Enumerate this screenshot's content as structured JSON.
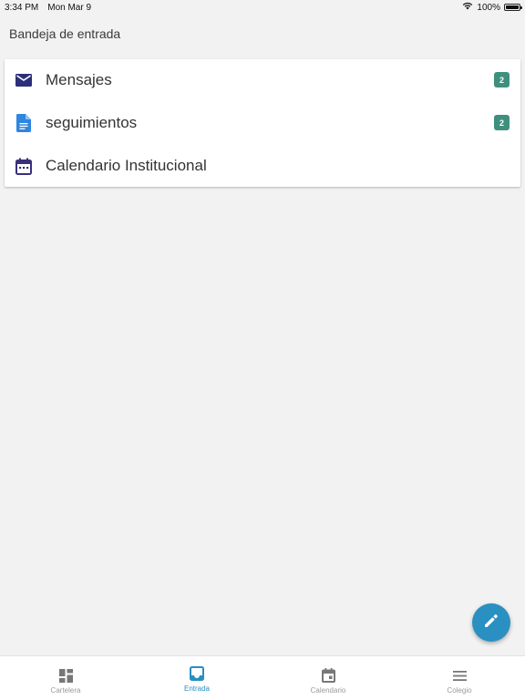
{
  "status_bar": {
    "time": "3:34 PM",
    "date": "Mon Mar 9",
    "battery": "100%"
  },
  "header": {
    "title": "Bandeja de entrada"
  },
  "inbox": {
    "items": [
      {
        "label": "Mensajes",
        "badge": "2",
        "icon": "mail-icon"
      },
      {
        "label": "seguimientos",
        "badge": "2",
        "icon": "document-icon"
      },
      {
        "label": "Calendario Institucional",
        "badge": "",
        "icon": "calendar-icon"
      }
    ]
  },
  "fab": {
    "icon": "pencil-icon"
  },
  "bottom_nav": {
    "items": [
      {
        "label": "Cartelera",
        "icon": "dashboard-icon",
        "active": false
      },
      {
        "label": "Entrada",
        "icon": "inbox-icon",
        "active": true
      },
      {
        "label": "Calendario",
        "icon": "calendar-icon",
        "active": false
      },
      {
        "label": "Colegio",
        "icon": "menu-icon",
        "active": false
      }
    ]
  },
  "colors": {
    "accent": "#2a8fc1",
    "badge": "#3f8f7f",
    "mail_icon": "#2b2f7a",
    "document_icon": "#2e86de",
    "calendar_icon": "#3a2f7a",
    "background": "#f2f2f2"
  }
}
